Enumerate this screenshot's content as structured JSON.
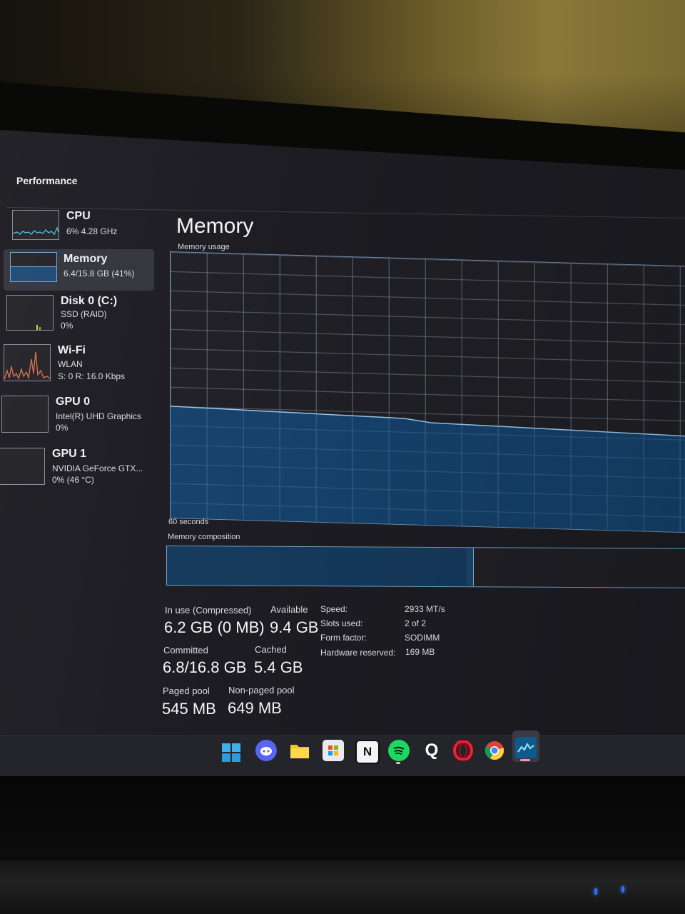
{
  "header": {
    "section_title": "Performance"
  },
  "sidebar": {
    "items": [
      {
        "name": "CPU",
        "line1": "6%  4.28 GHz",
        "line2": "",
        "color": "#4cc2e6"
      },
      {
        "name": "Memory",
        "line1": "6.4/15.8 GB (41%)",
        "line2": "",
        "color": "#3a7fc4",
        "active": true
      },
      {
        "name": "Disk 0 (C:)",
        "line1": "SSD (RAID)",
        "line2": "0%",
        "color": "#9acd32"
      },
      {
        "name": "Wi-Fi",
        "line1": "WLAN",
        "line2": "S: 0  R: 16.0 Kbps",
        "color": "#e06a4a"
      },
      {
        "name": "GPU 0",
        "line1": "Intel(R) UHD Graphics",
        "line2": "0%",
        "color": "#8b8b96"
      },
      {
        "name": "GPU 1",
        "line1": "NVIDIA GeForce GTX...",
        "line2": "0%  (46 °C)",
        "color": "#8b8b96"
      }
    ]
  },
  "main": {
    "title": "Memory",
    "usage_label": "Memory usage",
    "time_label": "60 seconds",
    "composition_label": "Memory composition",
    "usage_level": 0.42,
    "composition": {
      "in_use_fraction": 0.571,
      "modified_fraction": 0.013
    },
    "stats": {
      "in_use_label": "In use (Compressed)",
      "in_use_value": "6.2 GB (0 MB)",
      "available_label": "Available",
      "available_value": "9.4 GB",
      "committed_label": "Committed",
      "committed_value": "6.8/16.8 GB",
      "cached_label": "Cached",
      "cached_value": "5.4 GB",
      "paged_label": "Paged pool",
      "paged_value": "545 MB",
      "nonpaged_label": "Non-paged pool",
      "nonpaged_value": "649 MB"
    },
    "specs": [
      {
        "label": "Speed:",
        "value": "2933 MT/s"
      },
      {
        "label": "Slots used:",
        "value": "2 of 2"
      },
      {
        "label": "Form factor:",
        "value": "SODIMM"
      },
      {
        "label": "Hardware reserved:",
        "value": "169 MB"
      }
    ]
  },
  "taskbar": {
    "icons": [
      {
        "name": "start-icon",
        "glyph": ""
      },
      {
        "name": "discord-icon",
        "glyph": ""
      },
      {
        "name": "file-explorer-icon",
        "glyph": ""
      },
      {
        "name": "microsoft-store-icon",
        "glyph": ""
      },
      {
        "name": "notion-icon",
        "glyph": "N"
      },
      {
        "name": "spotify-icon",
        "glyph": ""
      },
      {
        "name": "quora-icon",
        "glyph": "Q"
      },
      {
        "name": "opera-icon",
        "glyph": ""
      },
      {
        "name": "chrome-icon",
        "glyph": ""
      },
      {
        "name": "task-manager-icon",
        "glyph": ""
      }
    ]
  }
}
